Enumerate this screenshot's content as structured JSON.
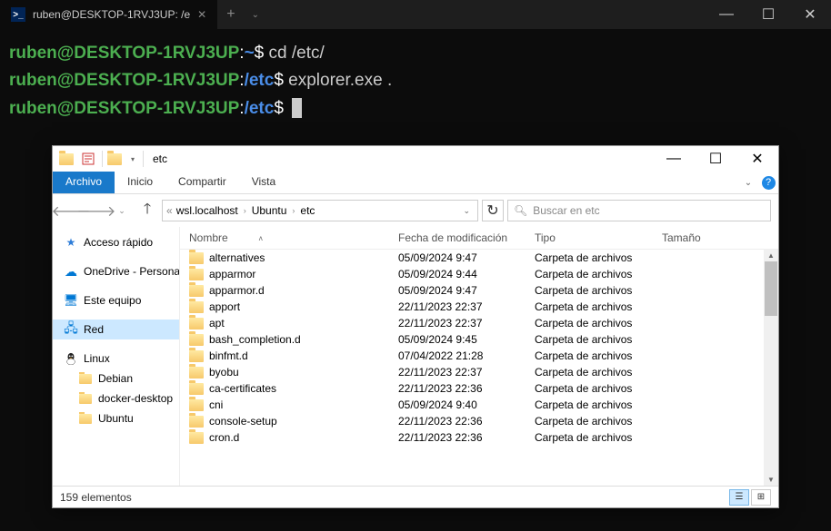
{
  "terminal": {
    "tab_title": "ruben@DESKTOP-1RVJ3UP: /e",
    "lines": [
      {
        "user": "ruben@DESKTOP-1RVJ3UP",
        "path": "~",
        "cmd": "cd /etc/"
      },
      {
        "user": "ruben@DESKTOP-1RVJ3UP",
        "path": "/etc",
        "cmd": "explorer.exe ."
      },
      {
        "user": "ruben@DESKTOP-1RVJ3UP",
        "path": "/etc",
        "cmd": ""
      }
    ]
  },
  "explorer": {
    "title": "etc",
    "ribbon": {
      "file": "Archivo",
      "home": "Inicio",
      "share": "Compartir",
      "view": "Vista"
    },
    "breadcrumbs": [
      "wsl.localhost",
      "Ubuntu",
      "etc"
    ],
    "search_placeholder": "Buscar en etc",
    "nav_pane": {
      "quick_access": "Acceso rápido",
      "onedrive": "OneDrive - Personal",
      "this_pc": "Este equipo",
      "network": "Red",
      "linux": "Linux",
      "linux_children": [
        "Debian",
        "docker-desktop",
        "Ubuntu"
      ]
    },
    "columns": {
      "name": "Nombre",
      "date": "Fecha de modificación",
      "type": "Tipo",
      "size": "Tamaño"
    },
    "files": [
      {
        "name": "alternatives",
        "date": "05/09/2024 9:47",
        "type": "Carpeta de archivos"
      },
      {
        "name": "apparmor",
        "date": "05/09/2024 9:44",
        "type": "Carpeta de archivos"
      },
      {
        "name": "apparmor.d",
        "date": "05/09/2024 9:47",
        "type": "Carpeta de archivos"
      },
      {
        "name": "apport",
        "date": "22/11/2023 22:37",
        "type": "Carpeta de archivos"
      },
      {
        "name": "apt",
        "date": "22/11/2023 22:37",
        "type": "Carpeta de archivos"
      },
      {
        "name": "bash_completion.d",
        "date": "05/09/2024 9:45",
        "type": "Carpeta de archivos"
      },
      {
        "name": "binfmt.d",
        "date": "07/04/2022 21:28",
        "type": "Carpeta de archivos"
      },
      {
        "name": "byobu",
        "date": "22/11/2023 22:37",
        "type": "Carpeta de archivos"
      },
      {
        "name": "ca-certificates",
        "date": "22/11/2023 22:36",
        "type": "Carpeta de archivos"
      },
      {
        "name": "cni",
        "date": "05/09/2024 9:40",
        "type": "Carpeta de archivos"
      },
      {
        "name": "console-setup",
        "date": "22/11/2023 22:36",
        "type": "Carpeta de archivos"
      },
      {
        "name": "cron.d",
        "date": "22/11/2023 22:36",
        "type": "Carpeta de archivos"
      }
    ],
    "status": "159 elementos"
  }
}
